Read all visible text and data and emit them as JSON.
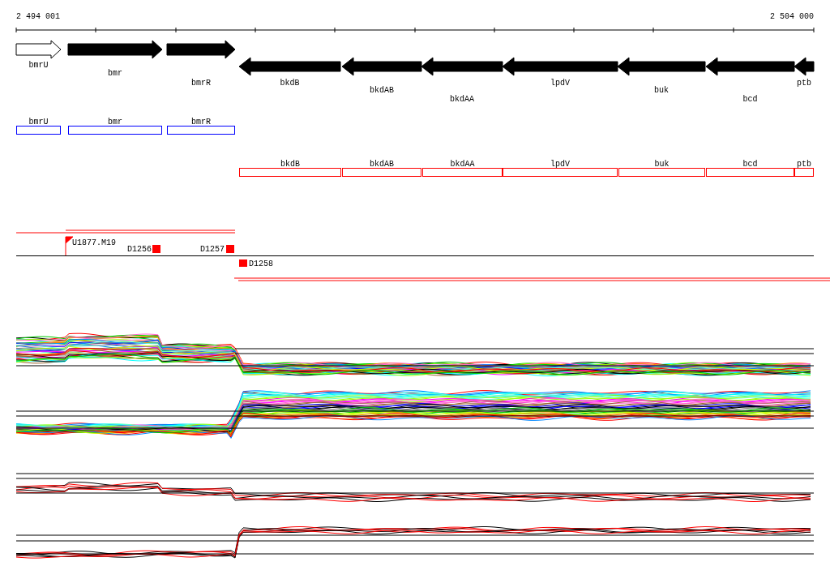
{
  "ruler": {
    "start_label": "2 494 001",
    "end_label": "2 504 000"
  },
  "genes": [
    {
      "name": "bmrU",
      "kind": "forward",
      "filled": false
    },
    {
      "name": "bmr",
      "kind": "forward",
      "filled": true
    },
    {
      "name": "bmrR",
      "kind": "forward",
      "filled": true
    },
    {
      "name": "bkdB",
      "kind": "reverse",
      "filled": true
    },
    {
      "name": "bkdAB",
      "kind": "reverse",
      "filled": true
    },
    {
      "name": "bkdAA",
      "kind": "reverse",
      "filled": true
    },
    {
      "name": "lpdV",
      "kind": "reverse",
      "filled": true
    },
    {
      "name": "buk",
      "kind": "reverse",
      "filled": true
    },
    {
      "name": "bcd",
      "kind": "reverse",
      "filled": true
    },
    {
      "name": "ptb",
      "kind": "reverse",
      "filled": true
    }
  ],
  "feature_tracks": [
    {
      "color": "#0000ff",
      "features": [
        "bmrU",
        "bmr",
        "bmrR"
      ]
    },
    {
      "color": "#ff0000",
      "features": [
        "bkdB",
        "bkdAB",
        "bkdAA",
        "lpdV",
        "buk",
        "bcd",
        "ptb"
      ]
    }
  ],
  "markers": [
    {
      "label": "U1877.M19",
      "kind": "flag"
    },
    {
      "label": "D1256",
      "kind": "block"
    },
    {
      "label": "D1257",
      "kind": "block"
    },
    {
      "label": "D1258",
      "kind": "below"
    }
  ]
}
